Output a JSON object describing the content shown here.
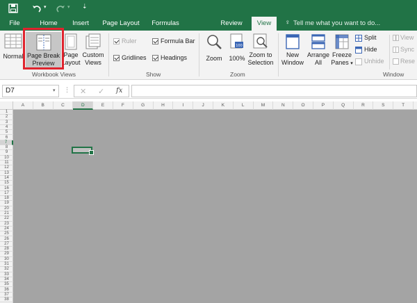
{
  "tabs": [
    "File",
    "Home",
    "Insert",
    "Page Layout",
    "Formulas",
    "Review",
    "View"
  ],
  "active_tab": "View",
  "tell_me": "Tell me what you want to do...",
  "workbook_views": {
    "normal": "Normal",
    "page_break_line1": "Page Break",
    "page_break_line2": "Preview",
    "page_layout_line1": "Page",
    "page_layout_line2": "Layout",
    "custom_views_line1": "Custom",
    "custom_views_line2": "Views",
    "group_label": "Workbook Views"
  },
  "show": {
    "ruler": "Ruler",
    "gridlines": "Gridlines",
    "formula_bar": "Formula Bar",
    "headings": "Headings",
    "group_label": "Show"
  },
  "zoom": {
    "zoom": "Zoom",
    "hundred": "100%",
    "zoom_sel_line1": "Zoom to",
    "zoom_sel_line2": "Selection",
    "group_label": "Zoom"
  },
  "window": {
    "new_line1": "New",
    "new_line2": "Window",
    "arrange_line1": "Arrange",
    "arrange_line2": "All",
    "freeze_line1": "Freeze",
    "freeze_line2": "Panes",
    "split": "Split",
    "hide": "Hide",
    "unhide": "Unhide",
    "view_side": "View",
    "sync": "Sync",
    "reset": "Rese",
    "group_label": "Window"
  },
  "formula_bar": {
    "name_box": "D7",
    "fx": "fx"
  },
  "columns": [
    "A",
    "B",
    "C",
    "D",
    "E",
    "F",
    "G",
    "H",
    "I",
    "J",
    "K",
    "L",
    "M",
    "N",
    "O",
    "P",
    "Q",
    "R",
    "S",
    "T"
  ],
  "rows": [
    "1",
    "2",
    "3",
    "4",
    "5",
    "6",
    "7",
    "8",
    "9",
    "10",
    "11",
    "12",
    "13",
    "14",
    "15",
    "16",
    "17",
    "18",
    "19",
    "20",
    "21",
    "22",
    "23",
    "24",
    "25",
    "26",
    "27",
    "28",
    "29",
    "30",
    "31",
    "32",
    "33",
    "34",
    "35",
    "36",
    "37",
    "38"
  ],
  "selected_cell": "D7",
  "accent": "#217346",
  "highlight_color": "#e0242e"
}
